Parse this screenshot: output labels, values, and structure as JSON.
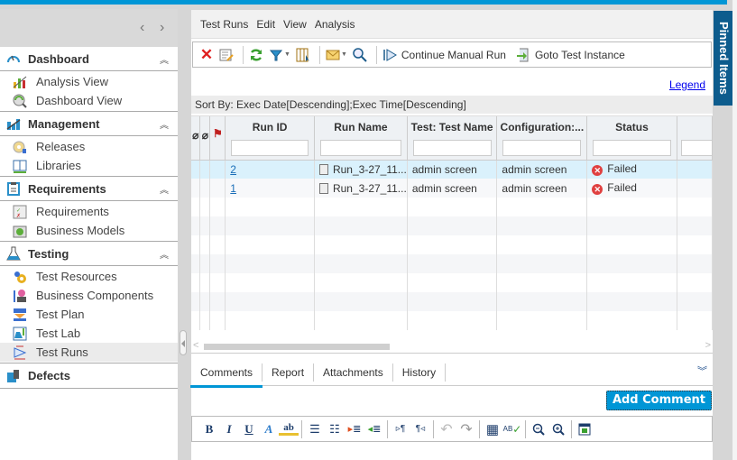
{
  "sidebar": {
    "nav_prev": "‹",
    "nav_next": "›",
    "groups": [
      {
        "label": "Dashboard",
        "icon": "gauge-icon",
        "items": [
          {
            "label": "Analysis View",
            "icon": "analysis-view-icon"
          },
          {
            "label": "Dashboard View",
            "icon": "dashboard-view-icon"
          }
        ]
      },
      {
        "label": "Management",
        "icon": "management-chart-icon",
        "items": [
          {
            "label": "Releases",
            "icon": "releases-icon"
          },
          {
            "label": "Libraries",
            "icon": "libraries-icon"
          }
        ]
      },
      {
        "label": "Requirements",
        "icon": "clipboard-icon",
        "items": [
          {
            "label": "Requirements",
            "icon": "requirements-icon"
          },
          {
            "label": "Business Models",
            "icon": "business-models-icon"
          }
        ]
      },
      {
        "label": "Testing",
        "icon": "flask-icon",
        "items": [
          {
            "label": "Test Resources",
            "icon": "test-resources-icon"
          },
          {
            "label": "Business Components",
            "icon": "business-components-icon"
          },
          {
            "label": "Test Plan",
            "icon": "test-plan-icon"
          },
          {
            "label": "Test Lab",
            "icon": "test-lab-icon"
          },
          {
            "label": "Test Runs",
            "icon": "test-runs-icon",
            "active": true
          }
        ]
      },
      {
        "label": "Defects",
        "icon": "defects-icon",
        "items": []
      }
    ],
    "collapse_glyph": "≈"
  },
  "menubar": {
    "items": [
      "Test Runs",
      "Edit",
      "View",
      "Analysis"
    ]
  },
  "toolbar": {
    "continue_manual_run": "Continue Manual Run",
    "goto_test_instance": "Goto Test Instance"
  },
  "legend_link": "Legend",
  "sort_by": "Sort By: Exec Date[Descending];Exec Time[Descending]",
  "grid": {
    "columns": [
      "Run ID",
      "Run Name",
      "Test: Test Name",
      "Configuration:...",
      "Status"
    ],
    "rows": [
      {
        "run_id": "2",
        "run_name": "Run_3-27_11...",
        "test_name": "admin screen",
        "configuration": "admin screen",
        "status": "Failed",
        "selected": true
      },
      {
        "run_id": "1",
        "run_name": "Run_3-27_11...",
        "test_name": "admin screen",
        "configuration": "admin screen",
        "status": "Failed",
        "selected": false
      }
    ]
  },
  "details": {
    "tabs": [
      "Comments",
      "Report",
      "Attachments",
      "History"
    ],
    "active_tab": "Comments",
    "add_comment": "Add Comment"
  },
  "pinned_items": "Pinned Items",
  "colors": {
    "accent": "#0096d6",
    "pinned_bg": "#0d5c8d",
    "selected_row": "#daf1fc",
    "failed": "#e04040"
  }
}
